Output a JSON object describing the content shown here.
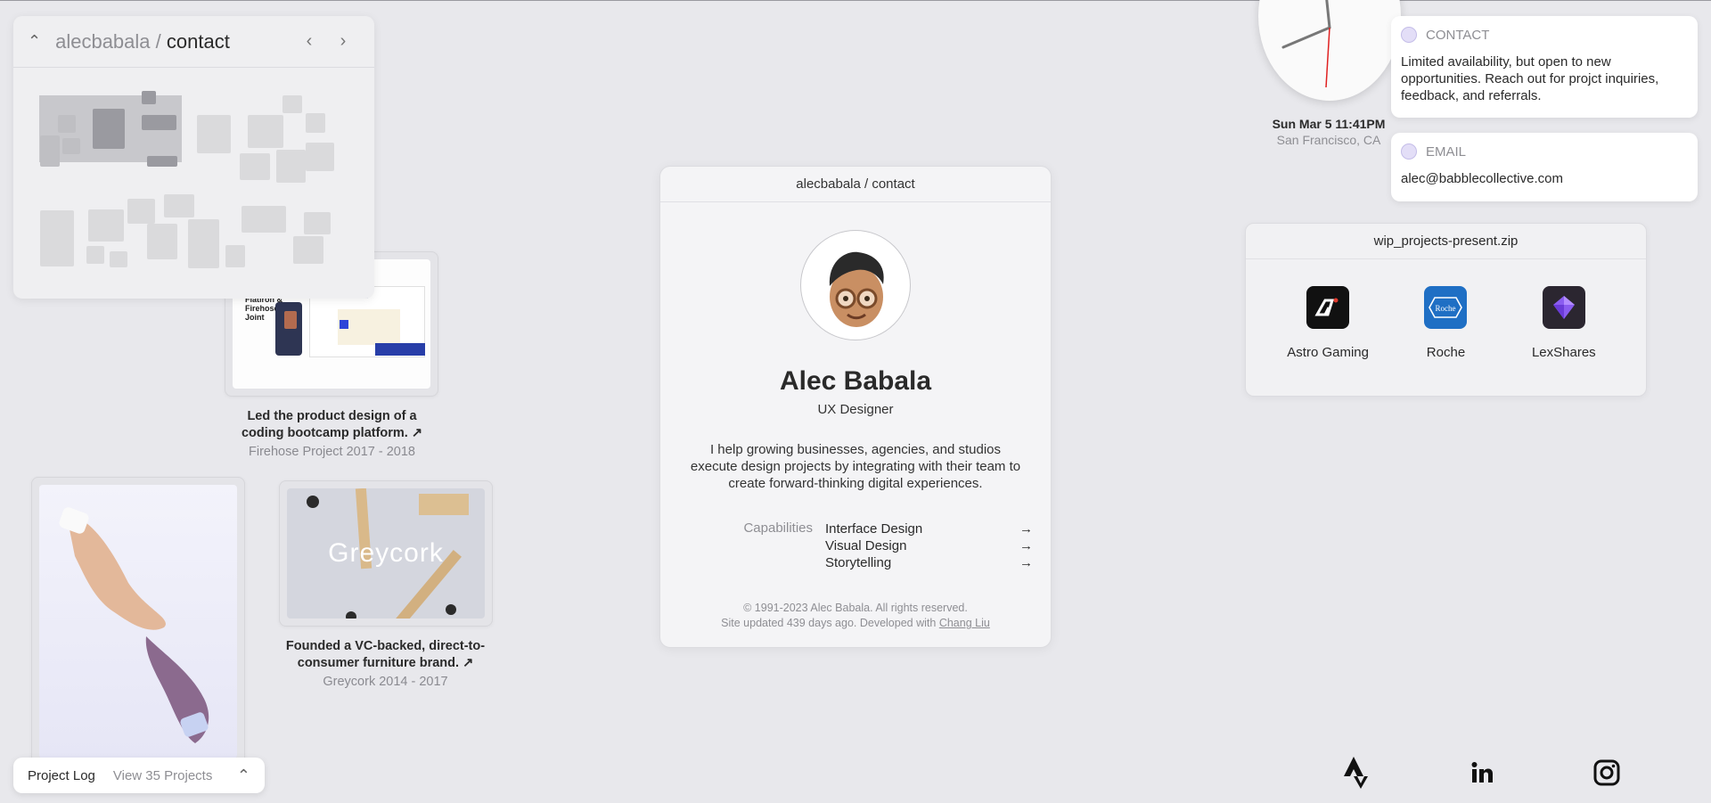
{
  "minimap": {
    "path_prefix": "alecbabala /",
    "path_current": "contact"
  },
  "projects": [
    {
      "title": "Led the product design of a coding bootcamp platform. ↗",
      "sub": "Firehose Project 2017 - 2018",
      "screen_text": "Flatiron & Firehose Joint"
    },
    {
      "title": "Founded a VC-backed, direct-to-consumer furniture brand. ↗",
      "sub": "Greycork 2014 - 2017",
      "image_text": "Greycork"
    }
  ],
  "contact_card": {
    "header": "alecbabala / contact",
    "name": "Alec Babala",
    "role": "UX Designer",
    "bio": "I help growing businesses, agencies, and studios execute design projects by integrating with their team to create forward-thinking digital experiences.",
    "capabilities_label": "Capabilities",
    "capabilities": [
      {
        "label": "Interface Design",
        "arrow": "→"
      },
      {
        "label": "Visual Design",
        "arrow": "→"
      },
      {
        "label": "Storytelling",
        "arrow": "→"
      }
    ],
    "footer_line1": "© 1991-2023 Alec Babala. All rights reserved.",
    "footer_line2_prefix": "Site updated 439 days ago. Developed with",
    "footer_link": "Chang Liu"
  },
  "clock": {
    "date": "Sun Mar 5 11:41PM",
    "city": "San Francisco, CA"
  },
  "notifications": [
    {
      "label": "CONTACT",
      "body": "Limited availability, but open to new opportunities. Reach out for projct inquiries, feedback, and referrals."
    },
    {
      "label": "EMAIL",
      "body": "alec@babblecollective.com"
    }
  ],
  "wip": {
    "title": "wip_projects-present.zip",
    "items": [
      {
        "label": "Astro Gaming",
        "icon": "astro-gaming-icon",
        "color": "#111111"
      },
      {
        "label": "Roche",
        "icon": "roche-icon",
        "color": "#1f6fc4",
        "icon_text": "Roche"
      },
      {
        "label": "LexShares",
        "icon": "lexshares-icon",
        "color": "#2b2630"
      }
    ]
  },
  "project_log": {
    "label": "Project Log",
    "view": "View 35 Projects"
  },
  "social": [
    "strava-icon",
    "linkedin-icon",
    "instagram-icon"
  ]
}
